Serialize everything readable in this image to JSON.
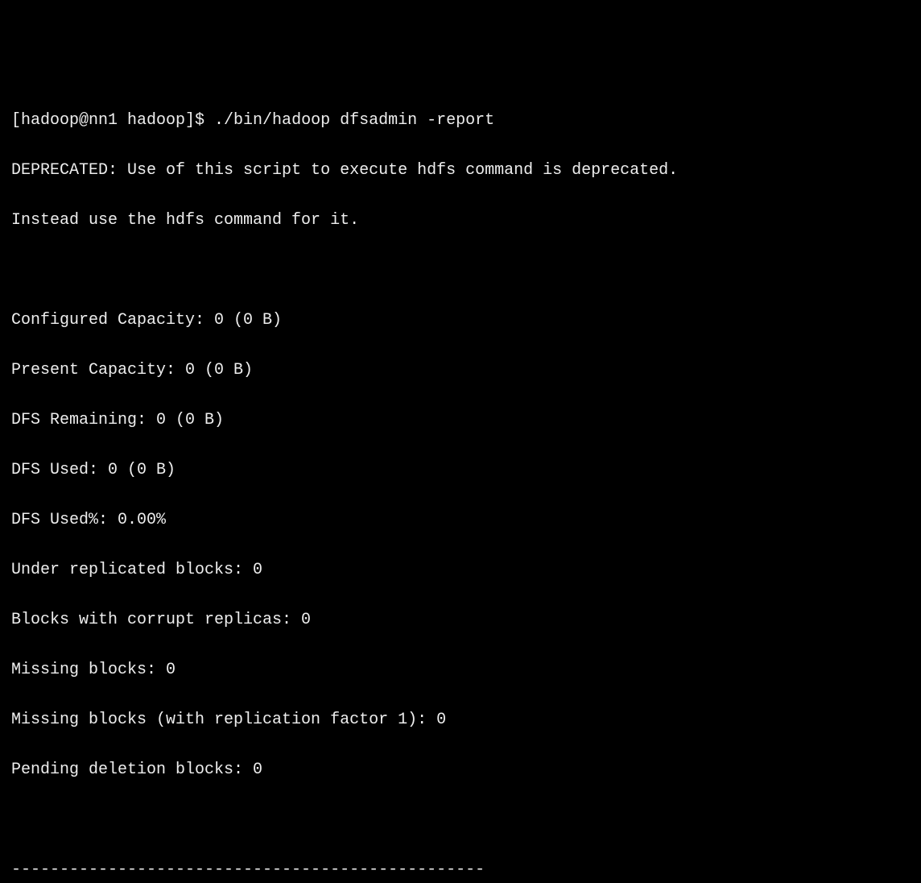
{
  "terminal": {
    "prompt": "[hadoop@nn1 hadoop]$ ",
    "command": "./bin/hadoop dfsadmin -report",
    "deprecated_l1": "DEPRECATED: Use of this script to execute hdfs command is deprecated.",
    "deprecated_l2": "Instead use the hdfs command for it.",
    "blank1": "",
    "configured_capacity": "Configured Capacity: 0 (0 B)",
    "present_capacity": "Present Capacity: 0 (0 B)",
    "dfs_remaining": "DFS Remaining: 0 (0 B)",
    "dfs_used": "DFS Used: 0 (0 B)",
    "dfs_used_pct": "DFS Used%: 0.00%",
    "under_replicated": "Under replicated blocks: 0",
    "corrupt_replicas": "Blocks with corrupt replicas: 0",
    "missing_blocks": "Missing blocks: 0",
    "missing_blocks_rf1": "Missing blocks (with replication factor 1): 0",
    "pending_deletion": "Pending deletion blocks: 0",
    "blank2": "",
    "separator": "-------------------------------------------------"
  }
}
